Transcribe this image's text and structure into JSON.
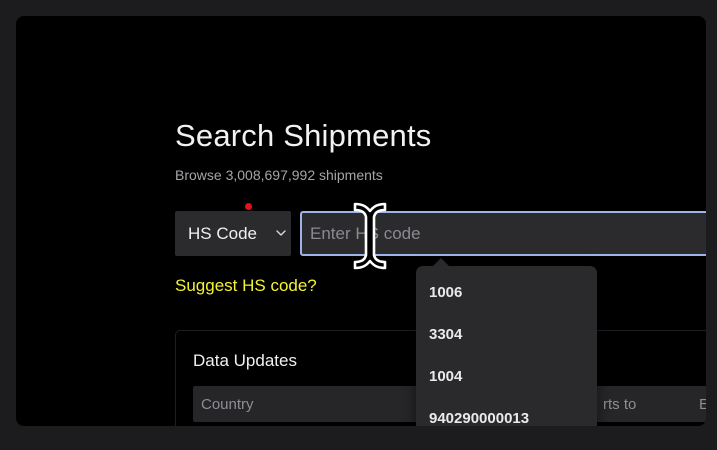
{
  "page": {
    "title": "Search Shipments",
    "subtitle": "Browse 3,008,697,992 shipments"
  },
  "search": {
    "type_selected": "HS Code",
    "placeholder": "Enter HS code",
    "value": ""
  },
  "suggest_link": "Suggest HS code?",
  "data_updates": {
    "title": "Data Updates",
    "columns": [
      "Country",
      "rts to",
      "E"
    ]
  },
  "dropdown": {
    "items": [
      "1006",
      "3304",
      "1004",
      "940290000013"
    ]
  },
  "icons": {
    "select_chevron": "chevron-down-icon",
    "cursor": "text-cursor-icon"
  },
  "colors": {
    "background": "#000000",
    "outer": "#1c1c1e",
    "input_bg": "#2b2b2d",
    "focus_border": "#9eb4e6",
    "link": "#f4f237",
    "indicator": "#e0141c"
  }
}
